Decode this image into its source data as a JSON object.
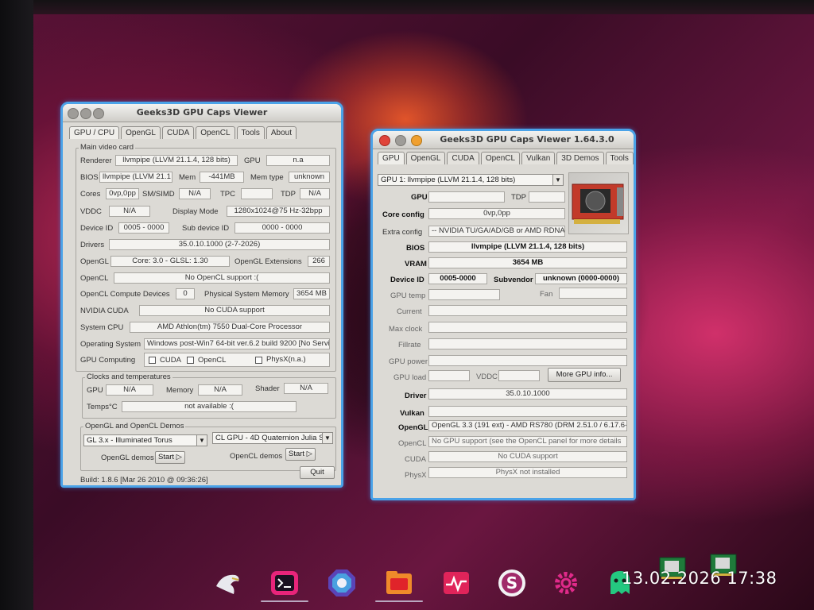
{
  "left_window": {
    "title": "Geeks3D GPU Caps Viewer",
    "tabs": [
      "GPU / CPU",
      "OpenGL",
      "CUDA",
      "OpenCL",
      "Tools",
      "About"
    ],
    "main_group": "Main video card",
    "renderer_label": "Renderer",
    "renderer_value": "llvmpipe (LLVM 21.1.4, 128 bits)",
    "gpu_label": "GPU",
    "gpu_value": "n.a",
    "bios_label": "BIOS",
    "bios_value": "llvmpipe (LLVM 21.1",
    "mem_label": "Mem",
    "mem_value": "-441MB",
    "memtype_label": "Mem type",
    "memtype_value": "unknown",
    "cores_label": "Cores",
    "cores_value": "0vp,0pp",
    "smsimd_label": "SM/SIMD",
    "smsimd_value": "N/A",
    "tpc_label": "TPC",
    "tpc_value": "",
    "tdp_label": "TDP",
    "tdp_value": "N/A",
    "vddc_label": "VDDC",
    "vddc_value": "N/A",
    "displaymode_label": "Display Mode",
    "displaymode_value": "1280x1024@75 Hz-32bpp",
    "deviceid_label": "Device ID",
    "deviceid_value": "0005 - 0000",
    "subdeviceid_label": "Sub device ID",
    "subdeviceid_value": "0000 - 0000",
    "drivers_label": "Drivers",
    "drivers_value": "35.0.10.1000 (2-7-2026)",
    "opengl_label": "OpenGL",
    "opengl_value": "Core: 3.0 - GLSL: 1.30",
    "openglext_label": "OpenGL Extensions",
    "openglext_value": "266",
    "opencl_label": "OpenCL",
    "opencl_value": "No OpenCL support :(",
    "openclcompute_label": "OpenCL Compute Devices",
    "openclcompute_value": "0",
    "physmem_label": "Physical System Memory",
    "physmem_value": "3654 MB",
    "nvcuda_label": "NVIDIA CUDA",
    "nvcuda_value": "No CUDA support",
    "syscpu_label": "System CPU",
    "syscpu_value": "AMD Athlon(tm) 7550 Dual-Core Processor",
    "os_label": "Operating System",
    "os_value": "Windows post-Win7 64-bit ver.6.2 build 9200 [No Servi",
    "gpucomputing_label": "GPU Computing",
    "chk_cuda": "CUDA",
    "chk_opencl": "OpenCL",
    "chk_physx": "PhysX(n.a.)",
    "clocks_group": "Clocks and temperatures",
    "clk_gpu_label": "GPU",
    "clk_gpu_value": "N/A",
    "clk_mem_label": "Memory",
    "clk_mem_value": "N/A",
    "clk_shader_label": "Shader",
    "clk_shader_value": "N/A",
    "temps_label": "Temps°C",
    "temps_value": "not available :(",
    "demos_group": "OpenGL and OpenCL Demos",
    "gl_demo_select": "GL 3.x - Illuminated Torus",
    "cl_demo_select": "CL GPU - 4D Quaternion Julia Se",
    "gl_demos_label": "OpenGL demos",
    "cl_demos_label": "OpenCL demos",
    "start_label": "Start ▷",
    "build": "Build: 1.8.6 [Mar 26 2010 @ 09:36:26]",
    "quit_label": "Quit"
  },
  "right_window": {
    "title": "Geeks3D GPU Caps Viewer 1.64.3.0",
    "tabs": [
      "GPU",
      "OpenGL",
      "CUDA",
      "OpenCL",
      "Vulkan",
      "3D Demos",
      "Tools"
    ],
    "gpu_select": "GPU 1: llvmpipe (LLVM 21.1.4, 128 bits)",
    "rows": {
      "gpu_label": "GPU",
      "gpu_value": "",
      "tdp_label": "TDP",
      "tdp_value": "",
      "coreconfig_label": "Core config",
      "coreconfig_value": "0vp,0pp",
      "extraconfig_label": "Extra config",
      "extraconfig_value": "-- NVIDIA TU/GA/AD/GB or AMD RDNA",
      "bios_label": "BIOS",
      "bios_value": "llvmpipe (LLVM 21.1.4, 128 bits)",
      "vram_label": "VRAM",
      "vram_value": "3654 MB",
      "deviceid_label": "Device ID",
      "deviceid_value": "0005-0000",
      "subvendor_label": "Subvendor",
      "subvendor_value": "unknown (0000-0000)",
      "gputemp_label": "GPU temp",
      "fan_label": "Fan",
      "current_label": "Current",
      "maxclock_label": "Max clock",
      "fillrate_label": "Fillrate",
      "gpupower_label": "GPU power",
      "gpuload_label": "GPU load",
      "vddc_label": "VDDC",
      "moregpu_label": "More GPU info...",
      "driver_label": "Driver",
      "driver_value": "35.0.10.1000",
      "vulkan_label": "Vulkan",
      "vulkan_value": "",
      "opengl_label": "OpenGL",
      "opengl_value": "OpenGL 3.3 (191 ext) - AMD RS780 (DRM 2.51.0 / 6.17.6-z",
      "opencl_label": "OpenCL",
      "opencl_value": "No GPU support (see the OpenCL panel for more details",
      "cuda_label": "CUDA",
      "cuda_value": "No CUDA support",
      "physx_label": "PhysX",
      "physx_value": "PhysX not installed"
    }
  },
  "taskbar": {
    "clock": "13.02.2026 17:38",
    "icons": [
      "eagle-icon",
      "terminal-icon",
      "blue-octagon-icon",
      "files-icon",
      "activity-monitor-icon",
      "s-circle-icon",
      "settings-gear-icon",
      "green-ghost-icon",
      "gpu-icon-1",
      "gpu-icon-2"
    ]
  },
  "colors": {
    "window_border": "#4aa2e8",
    "window_bg": "#dcdad5",
    "dock_orange": "#f08a2a",
    "dock_magenta": "#e02a8a",
    "dock_green": "#24c880"
  }
}
